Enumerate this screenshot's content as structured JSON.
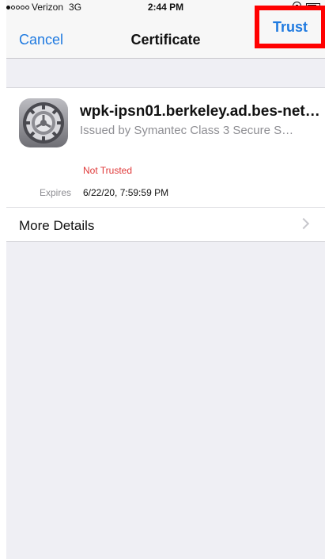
{
  "status_bar": {
    "carrier": "Verizon",
    "network": "3G",
    "time": "2:44 PM",
    "signal_bars_filled": 1,
    "signal_bars_total": 5,
    "lock_icon": "orientation-lock-icon",
    "battery_icon": "battery-icon"
  },
  "nav": {
    "cancel_label": "Cancel",
    "title": "Certificate",
    "trust_label": "Trust"
  },
  "certificate": {
    "icon": "settings-gear-icon",
    "name": "wpk-ipsn01.berkeley.ad.bes-net…",
    "issuer": "Issued by Symantec Class 3 Secure S…",
    "status": "Not Trusted",
    "expires_label": "Expires",
    "expires_value": "6/22/20, 7:59:59 PM"
  },
  "more_details": {
    "label": "More Details",
    "chevron_icon": "chevron-right-icon"
  },
  "colors": {
    "accent": "#1f7ae0",
    "warning": "#e03a3a",
    "highlight_box": "#ff0000",
    "background": "#efeff4"
  }
}
